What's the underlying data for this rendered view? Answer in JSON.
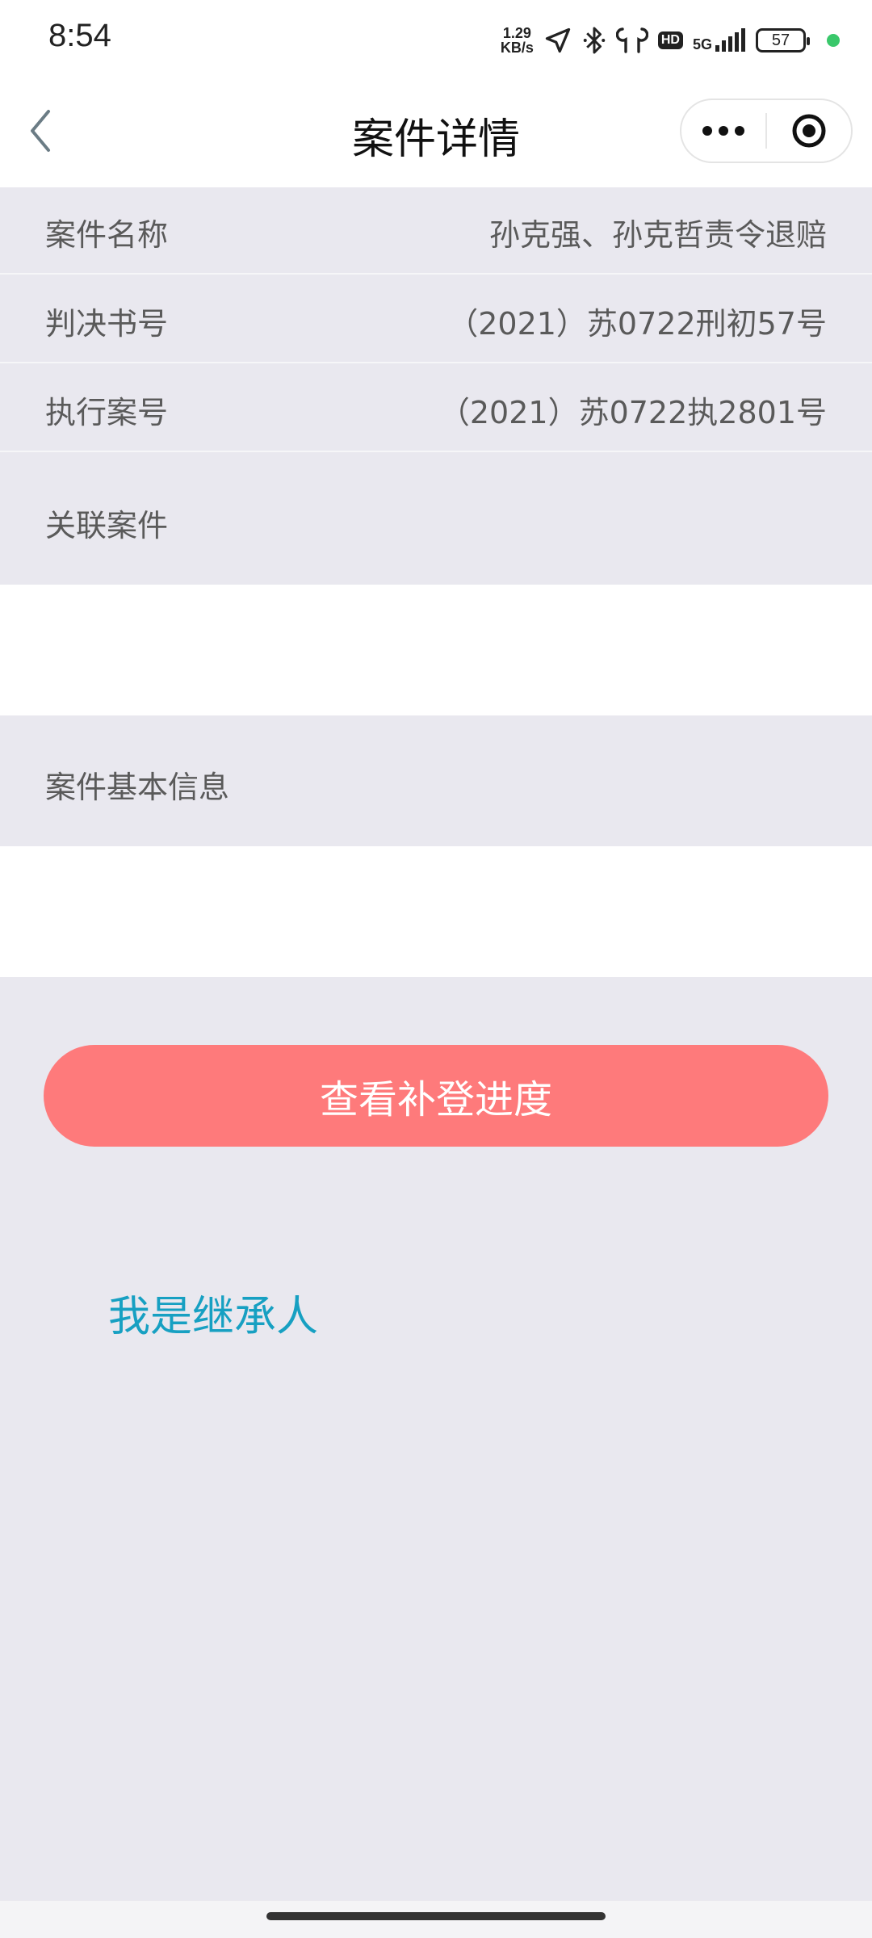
{
  "status_bar": {
    "time": "8:54",
    "net_speed_value": "1.29",
    "net_speed_unit": "KB/s",
    "hd": "HD",
    "network": "5G",
    "battery": "57"
  },
  "nav": {
    "title": "案件详情"
  },
  "details": [
    {
      "label": "案件名称",
      "value": "孙克强、孙克哲责令退赔"
    },
    {
      "label": "判决书号",
      "value": "（2021）苏0722刑初57号"
    },
    {
      "label": "执行案号",
      "value": "（2021）苏0722执2801号"
    }
  ],
  "sections": {
    "related_cases": "关联案件",
    "basic_info": "案件基本信息"
  },
  "actions": {
    "progress_button": "查看补登进度",
    "heir_link": "我是继承人"
  },
  "colors": {
    "accent_button": "#fe7a7b",
    "link": "#17a0c2",
    "background": "#e9e8ef"
  }
}
